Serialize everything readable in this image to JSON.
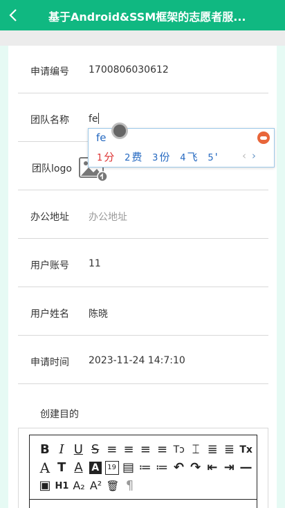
{
  "header": {
    "title": "基于Android&SSM框架的志愿者服..."
  },
  "form": {
    "apply_no": {
      "label": "申请编号",
      "value": "1700806030612"
    },
    "team_name": {
      "label": "团队名称",
      "value": "fe"
    },
    "team_logo": {
      "label": "团队logo"
    },
    "office_address": {
      "label": "办公地址",
      "placeholder": "办公地址"
    },
    "user_account": {
      "label": "用户账号",
      "value": "11"
    },
    "user_name": {
      "label": "用户姓名",
      "value": "陈晓"
    },
    "apply_time": {
      "label": "申请时间",
      "value": "2023-11-24 14:7:10"
    },
    "purpose": {
      "label": "创建目的"
    }
  },
  "ime": {
    "code": "fe",
    "candidates": [
      {
        "num": "1",
        "text": "分"
      },
      {
        "num": "2",
        "text": "费"
      },
      {
        "num": "3",
        "text": "份"
      },
      {
        "num": "4",
        "text": "飞"
      },
      {
        "num": "5",
        "text": "'"
      }
    ],
    "prev": "‹",
    "next": "›"
  },
  "toolbar": {
    "row1": [
      "B",
      "I",
      "U",
      "S",
      "≡",
      "≡",
      "≡",
      "≡",
      "Tↄ",
      "⌶",
      "≣",
      "≣",
      "Tx"
    ],
    "row2": [
      "A",
      "T",
      "A",
      "A",
      "19",
      "▤",
      "≔",
      "≔",
      "↶",
      "↷",
      "⇤",
      "⇥",
      "—"
    ],
    "row3": [
      "▣",
      "H1",
      "A₂",
      "A²",
      "🗑",
      "¶"
    ]
  },
  "colors": {
    "brand": "#10b881",
    "ime_accent": "#2468c0",
    "candidate_first": "#dd3333"
  }
}
